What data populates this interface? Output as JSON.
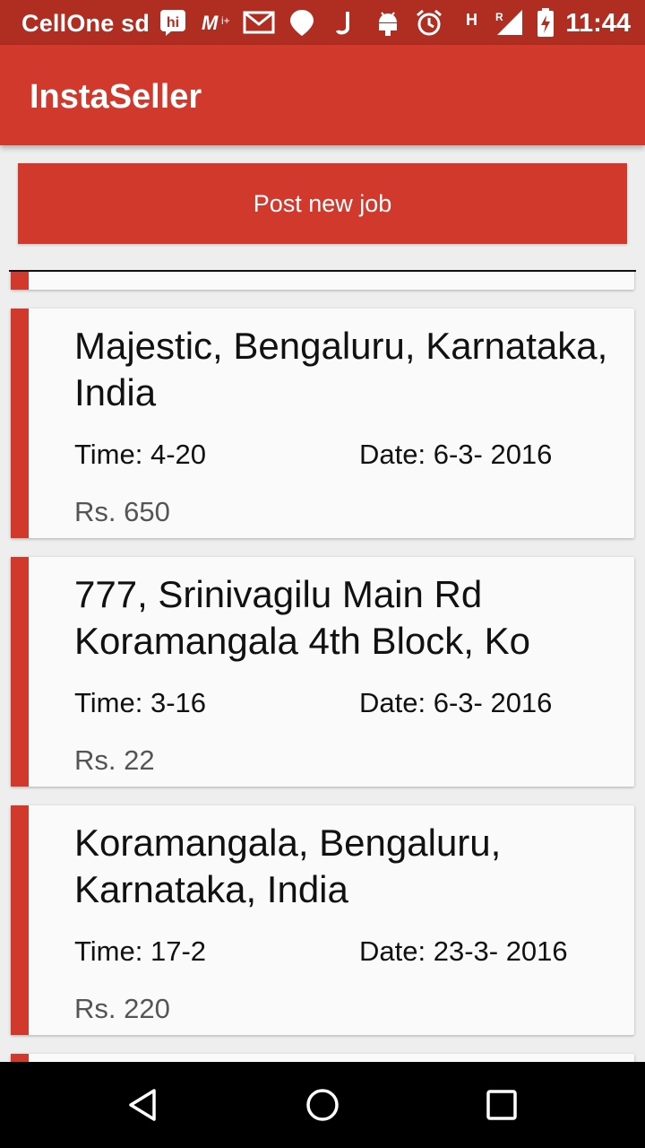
{
  "status_bar": {
    "carrier": "CellOne sd",
    "time": "11:44",
    "icons": [
      "hike-icon",
      "mi-icon",
      "gmail-icon",
      "location-icon",
      "j-icon",
      "android-icon",
      "alarm-icon",
      "h-network-icon",
      "signal-icon",
      "battery-charging-icon"
    ]
  },
  "app_bar": {
    "title": "InstaSeller"
  },
  "actions": {
    "post_job_label": "Post new job"
  },
  "jobs": [
    {
      "address": "Majestic, Bengaluru, Karnataka, India",
      "time": "Time: 4-20",
      "date": "Date: 6-3- 2016",
      "price": "Rs. 650"
    },
    {
      "address": "777, Srinivagilu Main Rd Koramangala 4th Block, Ko",
      "time": "Time: 3-16",
      "date": "Date: 6-3- 2016",
      "price": "Rs. 22"
    },
    {
      "address": "Koramangala, Bengaluru, Karnataka, India",
      "time": "Time: 17-2",
      "date": "Date: 23-3- 2016",
      "price": "Rs. 220"
    }
  ],
  "colors": {
    "primary": "#d0392b",
    "primary_dark": "#b02d22",
    "background": "#eeeeee",
    "card": "#fafafa"
  },
  "nav_bar": {
    "icons": [
      "back-icon",
      "home-icon",
      "recents-icon"
    ]
  }
}
